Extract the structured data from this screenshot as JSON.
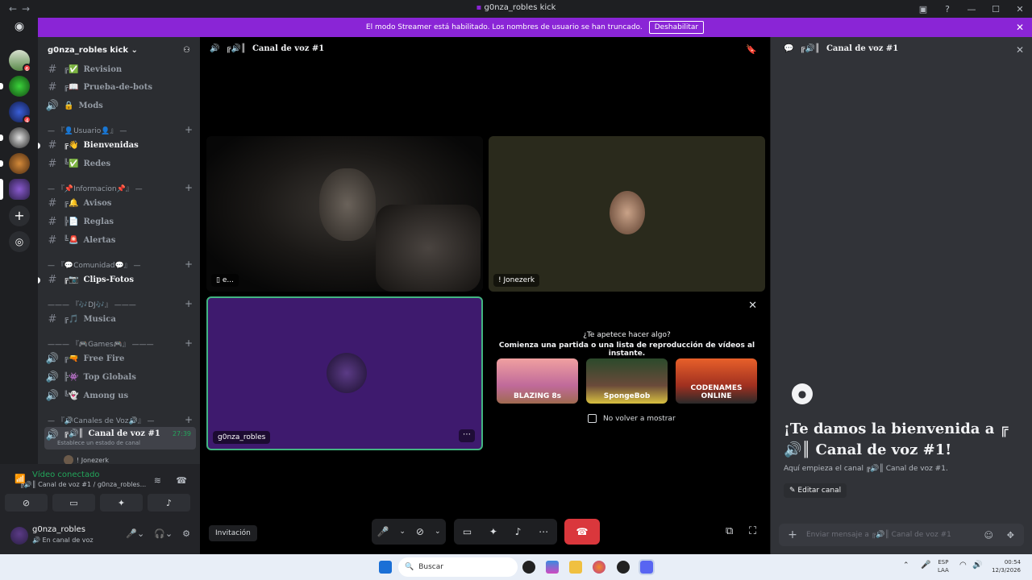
{
  "window": {
    "title": "g0nza_robles kick",
    "back": "←",
    "forward": "→"
  },
  "banner": {
    "text": "El modo Streamer está habilitado. Los nombres de usuario se han truncado.",
    "button": "Deshabilitar"
  },
  "guilds": {
    "badges": [
      "6",
      "4"
    ]
  },
  "server": {
    "name": "g0nza_robles kick"
  },
  "channels": [
    {
      "type": "text",
      "emoji": "╔✅",
      "name": "Revision"
    },
    {
      "type": "text",
      "emoji": "╔📖",
      "name": "Prueba-de-bots"
    },
    {
      "type": "voice",
      "emoji": "🔒",
      "name": "Mods"
    },
    {
      "type": "category",
      "name": "— 『👤Usuario👤』 —"
    },
    {
      "type": "text",
      "emoji": "╔👋",
      "name": "Bienvenidas",
      "unread": true
    },
    {
      "type": "text",
      "emoji": "╚✅",
      "name": "Redes"
    },
    {
      "type": "category",
      "name": "— 『📌Informacion📌』 —"
    },
    {
      "type": "text",
      "emoji": "╔🔔",
      "name": "Avisos"
    },
    {
      "type": "text",
      "emoji": "╠📄",
      "name": "Reglas"
    },
    {
      "type": "text",
      "emoji": "╚🚨",
      "name": "Alertas"
    },
    {
      "type": "category",
      "name": "— 『💬Comunidad💬』 —"
    },
    {
      "type": "text",
      "emoji": "╔📷",
      "name": "Clips-Fotos",
      "unread": true
    },
    {
      "type": "category",
      "name": "——— 『🎶DJ🎶』 ———"
    },
    {
      "type": "text",
      "emoji": "╔🎵",
      "name": "Musica"
    },
    {
      "type": "category",
      "name": "——— 『🎮Games🎮』 ———"
    },
    {
      "type": "voice",
      "emoji": "╔🔫",
      "name": "Free Fire"
    },
    {
      "type": "voice",
      "emoji": "╠👾",
      "name": "Top Globals"
    },
    {
      "type": "voice",
      "emoji": "╚👻",
      "name": "Among us"
    },
    {
      "type": "category",
      "name": "— 『🔊Canales de Voz🔊』 —"
    }
  ],
  "active_channel": {
    "emoji": "╔🔊║",
    "name": "Canal de voz #1",
    "timer": "27:39",
    "status": "Establece un estado de canal",
    "member": "! Jonezerk"
  },
  "voice": {
    "status": "Vídeo conectado",
    "location": "Canal de voz #1 / g0nza_robles..."
  },
  "user": {
    "name": "g0nza_robles",
    "status": "En canal de voz"
  },
  "stage": {
    "title": "Canal de voz #1",
    "tiles": [
      "e...",
      "! Jonezerk",
      "g0nza_robles"
    ],
    "invite": "Invitación"
  },
  "activity": {
    "line1": "¿Te apetece hacer algo?",
    "line2": "Comienza una partida o una lista de reproducción de vídeos al instante.",
    "games": [
      "BLAZING 8s",
      "SpongeBob",
      "CODENAMES ONLINE"
    ],
    "checkbox": "No volver a mostrar"
  },
  "right": {
    "title": "Canal de voz #1",
    "welcome": "¡Te damos la bienvenida a ╔🔊║ Canal de voz #1!",
    "desc": "Aquí empieza el canal ╔🔊║ Canal de voz #1.",
    "edit": "Editar canal",
    "placeholder": "Enviar mensaje a ╔🔊║ Canal de voz #1"
  },
  "taskbar": {
    "search": "Buscar",
    "lang": "ESP",
    "region": "LAA",
    "time": "00:54",
    "date": "12/3/2026"
  }
}
